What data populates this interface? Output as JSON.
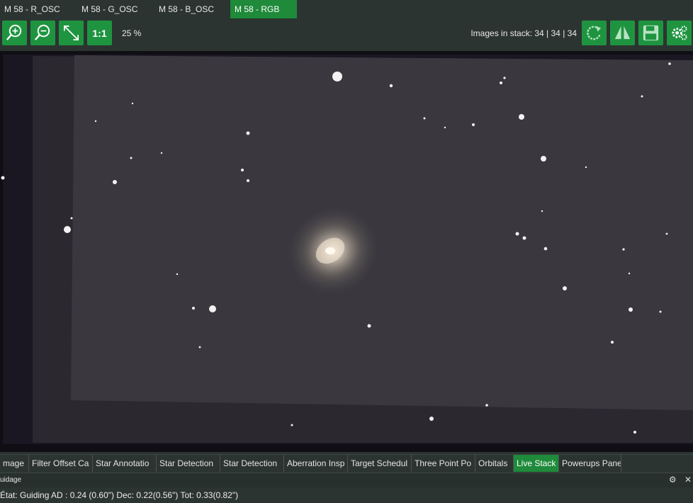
{
  "tabs": [
    {
      "label": "M 58 - R_OSC",
      "active": false
    },
    {
      "label": "M 58 - G_OSC",
      "active": false
    },
    {
      "label": "M 58 - B_OSC",
      "active": false
    },
    {
      "label": "M 58 - RGB",
      "active": true
    }
  ],
  "toolbar": {
    "zoom_in_icon": "zoom-in-icon",
    "zoom_out_icon": "zoom-out-icon",
    "fit_icon": "fit-to-window-icon",
    "one_to_one_label": "1:1",
    "zoom_level": "25 %",
    "stack_info": "Images in stack: 34 | 34 | 34",
    "refresh_icon": "refresh-icon",
    "flip_icon": "flip-icon",
    "save_icon": "save-icon",
    "settings_icon": "settings-icon",
    "accent": "#1f9440"
  },
  "bottom_tabs": [
    {
      "label": "mage",
      "active": false
    },
    {
      "label": "Filter Offset Ca",
      "active": false
    },
    {
      "label": "Star Annotatio",
      "active": false
    },
    {
      "label": "Star Detection",
      "active": false
    },
    {
      "label": "Star Detection",
      "active": false
    },
    {
      "label": "Aberration Insp",
      "active": false
    },
    {
      "label": "Target Schedul",
      "active": false
    },
    {
      "label": "Three Point Po",
      "active": false
    },
    {
      "label": "Orbitals",
      "active": false
    },
    {
      "label": "Live Stack",
      "active": true
    },
    {
      "label": "Powerups Pane",
      "active": false
    }
  ],
  "guide_panel": {
    "title": "uidage",
    "status": "État: Guiding  AD : 0.24 (0.60\")  Dec: 0.22(0.56\")  Tot: 0.33(0.82\")",
    "settings_icon": "gear-icon",
    "close_icon": "close-icon"
  }
}
